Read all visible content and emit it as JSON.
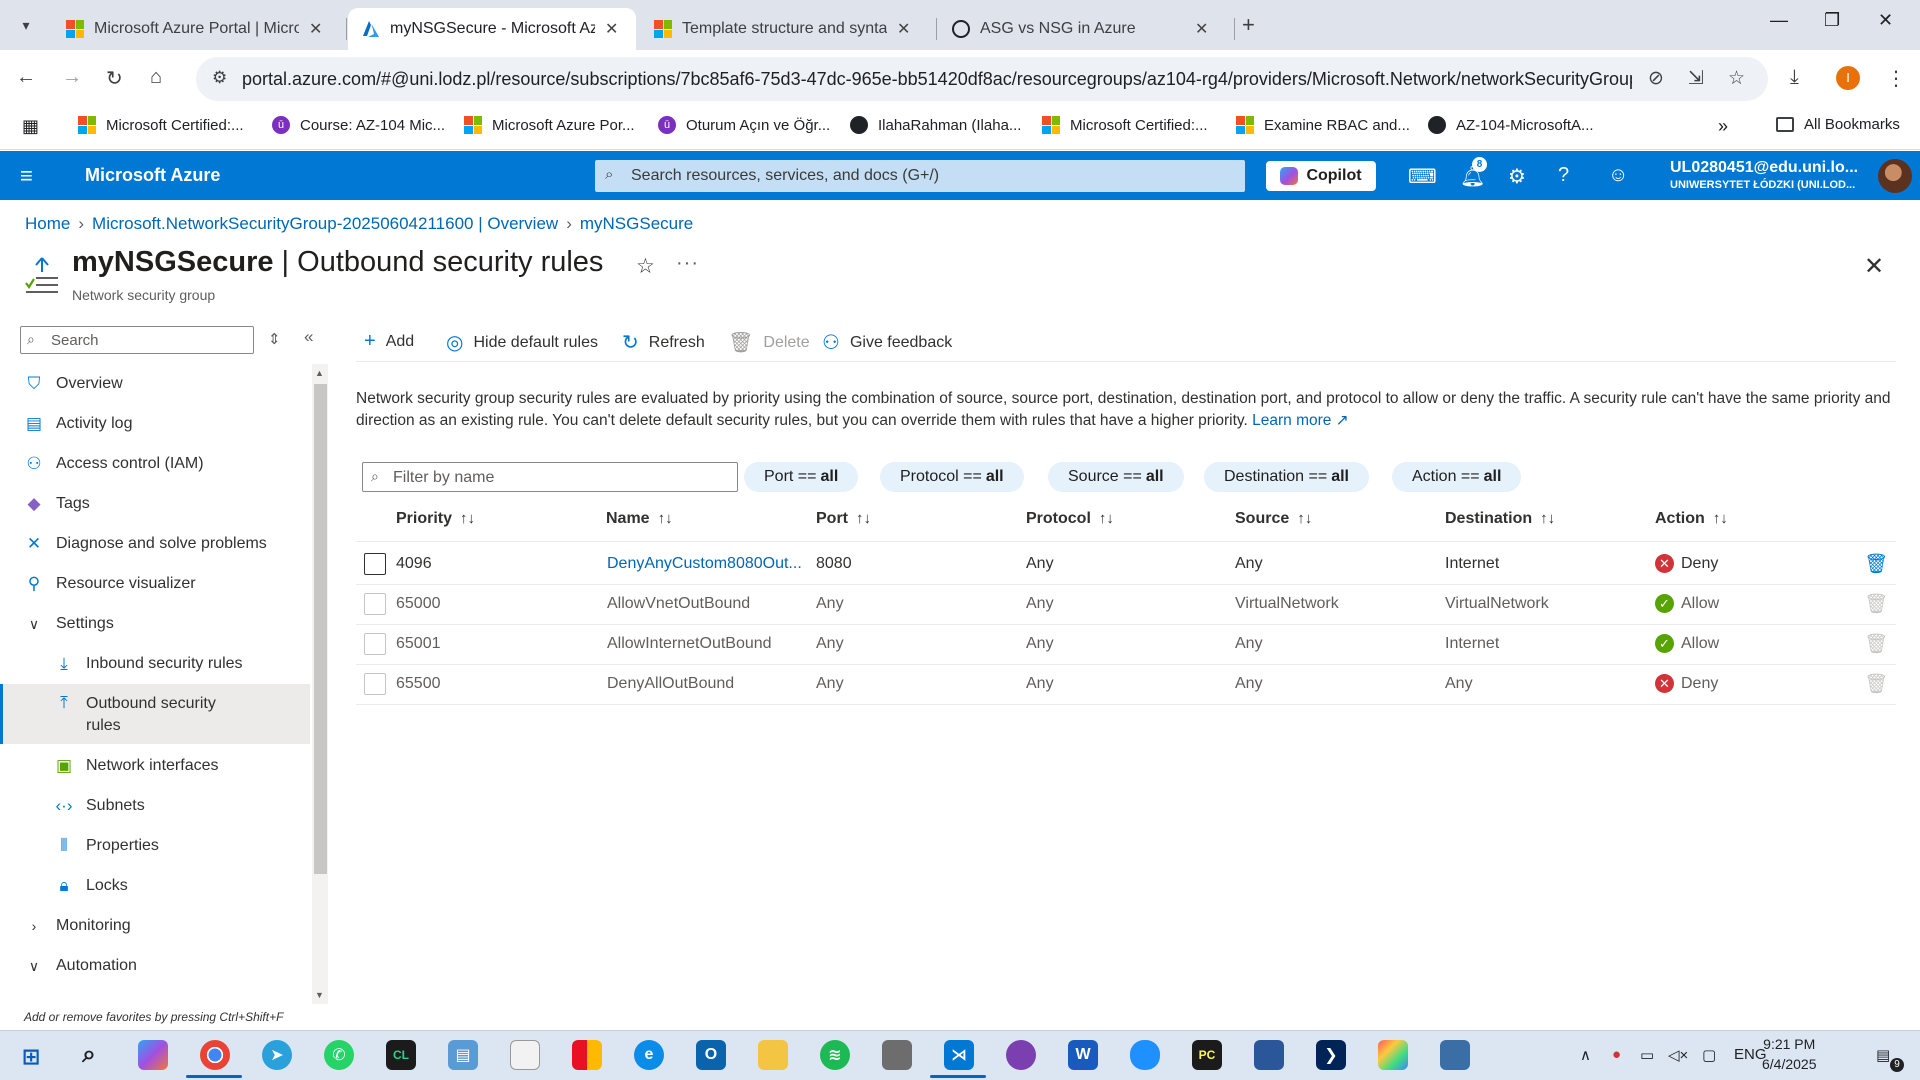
{
  "browser": {
    "tabs": [
      {
        "title": "Microsoft Azure Portal | Microsoft",
        "icon": "microsoft-logo",
        "active": false
      },
      {
        "title": "myNSGSecure - Microsoft Azure",
        "icon": "azure-logo",
        "active": true
      },
      {
        "title": "Template structure and syntax -",
        "icon": "microsoft-logo",
        "active": false
      },
      {
        "title": "ASG vs NSG in Azure",
        "icon": "chatgpt-logo",
        "active": false
      }
    ],
    "url": "portal.azure.com/#@uni.lodz.pl/resource/subscriptions/7bc85af6-75d3-47dc-965e-bb51420df8ac/resourcegroups/az104-rg4/providers/Microsoft.Network/networkSecurityGroups...",
    "profile_initial": "I",
    "bookmarks": [
      {
        "label": "Microsoft Certified:...",
        "icon": "microsoft-logo"
      },
      {
        "label": "Course: AZ-104 Mic...",
        "icon": "udemy-icon"
      },
      {
        "label": "Microsoft Azure Por...",
        "icon": "microsoft-logo"
      },
      {
        "label": "Oturum Açın ve Öğr...",
        "icon": "udemy-icon"
      },
      {
        "label": "IlahaRahman (Ilaha...",
        "icon": "github-icon"
      },
      {
        "label": "Microsoft Certified:...",
        "icon": "microsoft-logo"
      },
      {
        "label": "Examine RBAC and...",
        "icon": "microsoft-logo"
      },
      {
        "label": "AZ-104-MicrosoftA...",
        "icon": "github-icon"
      }
    ],
    "all_bookmarks": "All Bookmarks"
  },
  "azure": {
    "brand": "Microsoft Azure",
    "search_placeholder": "Search resources, services, and docs (G+/)",
    "copilot": "Copilot",
    "notification_count": "8",
    "account_email": "UL0280451@edu.uni.lo...",
    "account_org": "UNIWERSYTET ŁÓDZKI (UNI.LOD..."
  },
  "breadcrumb": [
    "Home",
    "Microsoft.NetworkSecurityGroup-20250604211600 | Overview",
    "myNSGSecure"
  ],
  "page": {
    "resource": "myNSGSecure",
    "title_sep": " | ",
    "section": "Outbound security rules",
    "subtitle": "Network security group"
  },
  "nav": {
    "search_placeholder": "Search",
    "items": [
      {
        "label": "Overview",
        "icon": "shield-icon",
        "level": 0
      },
      {
        "label": "Activity log",
        "icon": "activity-log-icon",
        "level": 0
      },
      {
        "label": "Access control (IAM)",
        "icon": "iam-icon",
        "level": 0
      },
      {
        "label": "Tags",
        "icon": "tag-icon",
        "level": 0
      },
      {
        "label": "Diagnose and solve problems",
        "icon": "wrench-icon",
        "level": 0
      },
      {
        "label": "Resource visualizer",
        "icon": "visualizer-icon",
        "level": 0
      },
      {
        "label": "Settings",
        "icon": "chevron-down-icon",
        "level": 0,
        "group": true
      },
      {
        "label": "Inbound security rules",
        "icon": "inbound-rules-icon",
        "level": 1
      },
      {
        "label": "Outbound security rules",
        "icon": "outbound-rules-icon",
        "level": 1,
        "active": true
      },
      {
        "label": "Network interfaces",
        "icon": "nic-icon",
        "level": 1
      },
      {
        "label": "Subnets",
        "icon": "subnet-icon",
        "level": 1
      },
      {
        "label": "Properties",
        "icon": "properties-icon",
        "level": 1
      },
      {
        "label": "Locks",
        "icon": "lock-icon",
        "level": 1
      },
      {
        "label": "Monitoring",
        "icon": "chevron-right-icon",
        "level": 0,
        "group": true
      },
      {
        "label": "Automation",
        "icon": "chevron-down-icon",
        "level": 0,
        "group": true
      }
    ],
    "hint": "Add or remove favorites by pressing Ctrl+Shift+F"
  },
  "toolbar": {
    "add": "Add",
    "hide_default": "Hide default rules",
    "refresh": "Refresh",
    "delete": "Delete",
    "feedback": "Give feedback"
  },
  "description": {
    "text": "Network security group security rules are evaluated by priority using the combination of source, source port, destination, destination port, and protocol to allow or deny the traffic. A security rule can't have the same priority and direction as an existing rule. You can't delete default security rules, but you can override them with rules that have a higher priority.",
    "link": "Learn more"
  },
  "filters": {
    "placeholder": "Filter by name",
    "pills": [
      {
        "key": "Port ==",
        "value": "all"
      },
      {
        "key": "Protocol ==",
        "value": "all"
      },
      {
        "key": "Source ==",
        "value": "all"
      },
      {
        "key": "Destination ==",
        "value": "all"
      },
      {
        "key": "Action ==",
        "value": "all"
      }
    ]
  },
  "table": {
    "columns": [
      "Priority",
      "Name",
      "Port",
      "Protocol",
      "Source",
      "Destination",
      "Action"
    ],
    "rows": [
      {
        "priority": "4096",
        "name": "DenyAnyCustom8080Out...",
        "port": "8080",
        "protocol": "Any",
        "source": "Any",
        "destination": "Internet",
        "action": "Deny",
        "custom": true
      },
      {
        "priority": "65000",
        "name": "AllowVnetOutBound",
        "port": "Any",
        "protocol": "Any",
        "source": "VirtualNetwork",
        "destination": "VirtualNetwork",
        "action": "Allow",
        "custom": false
      },
      {
        "priority": "65001",
        "name": "AllowInternetOutBound",
        "port": "Any",
        "protocol": "Any",
        "source": "Any",
        "destination": "Internet",
        "action": "Allow",
        "custom": false
      },
      {
        "priority": "65500",
        "name": "DenyAllOutBound",
        "port": "Any",
        "protocol": "Any",
        "source": "Any",
        "destination": "Any",
        "action": "Deny",
        "custom": false
      }
    ],
    "colors": {
      "deny": "#d13438",
      "allow": "#57a300",
      "link": "#0067b8"
    }
  },
  "taskbar": {
    "language": "ENG",
    "time": "9:21 PM",
    "date": "6/4/2025",
    "notification_count": "9"
  }
}
